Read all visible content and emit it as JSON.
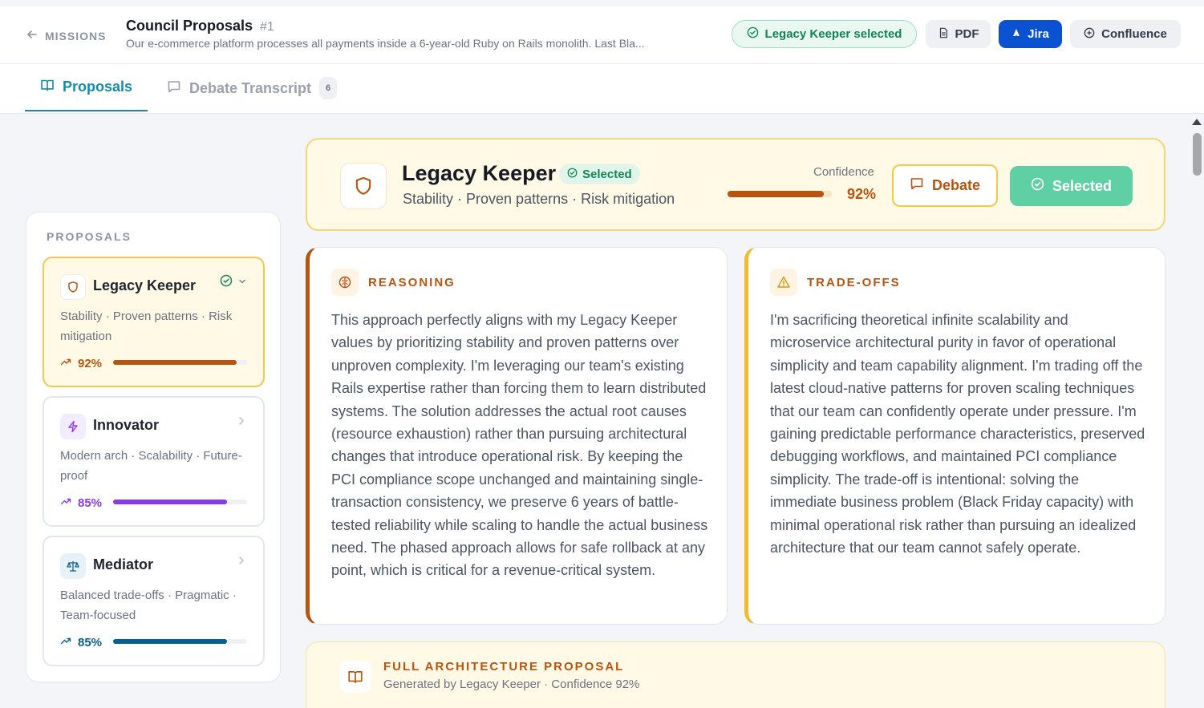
{
  "header": {
    "back_label": "MISSIONS",
    "title": "Council Proposals",
    "title_number": "#1",
    "subtitle": "Our e-commerce platform processes all payments inside a 6-year-old Ruby on Rails monolith. Last Bla...",
    "selected_pill": "Legacy Keeper selected",
    "pdf_label": "PDF",
    "jira_label": "Jira",
    "confluence_label": "Confluence"
  },
  "tabs": [
    {
      "label": "Proposals",
      "active": true
    },
    {
      "label": "Debate Transcript",
      "count": "6"
    }
  ],
  "sidebar": {
    "heading": "PROPOSALS",
    "items": [
      {
        "name": "Legacy Keeper",
        "tags": "Stability · Proven patterns · Risk mitigation",
        "confidence": "92%",
        "confidence_value": 0.92,
        "color": "#b7540f",
        "icon": "shield-icon",
        "selected": true
      },
      {
        "name": "Innovator",
        "tags": "Modern arch · Scalability · Future-proof",
        "confidence": "85%",
        "confidence_value": 0.85,
        "color": "#8a3ae8",
        "icon": "lightning-icon"
      },
      {
        "name": "Mediator",
        "tags": "Balanced trade-offs · Pragmatic · Team-focused",
        "confidence": "85%",
        "confidence_value": 0.85,
        "color": "#0b5f8f",
        "icon": "scale-icon"
      }
    ]
  },
  "hero": {
    "name": "Legacy Keeper",
    "badge": "Selected",
    "tags": "Stability · Proven patterns · Risk mitigation",
    "confidence_label": "Confidence",
    "confidence": "92%",
    "confidence_value": 0.92,
    "debate_label": "Debate",
    "selected_label": "Selected"
  },
  "reasoning": {
    "title": "REASONING",
    "text": "This approach perfectly aligns with my Legacy Keeper values by prioritizing stability and proven patterns over unproven complexity. I'm leveraging our team's existing Rails expertise rather than forcing them to learn distributed systems. The solution addresses the actual root causes (resource exhaustion) rather than pursuing architectural changes that introduce operational risk. By keeping the PCI compliance scope unchanged and maintaining single-transaction consistency, we preserve 6 years of battle-tested reliability while scaling to handle the actual business need. The phased approach allows for safe rollback at any point, which is critical for a revenue-critical system."
  },
  "tradeoffs": {
    "title": "TRADE-OFFS",
    "text": "I'm sacrificing theoretical infinite scalability and microservice architectural purity in favor of operational simplicity and team capability alignment. I'm trading off the latest cloud-native patterns for proven scaling techniques that our team can confidently operate under pressure. I'm gaining predictable performance characteristics, preserved debugging workflows, and maintained PCI compliance simplicity. The trade-off is intentional: solving the immediate business problem (Black Friday capacity) with minimal operational risk rather than pursuing an idealized architecture that our team cannot safely operate."
  },
  "full_proposal": {
    "title": "FULL ARCHITECTURE PROPOSAL",
    "subtitle": "Generated by Legacy Keeper · Confidence 92%"
  },
  "colors": {
    "accent": "#168aa6",
    "legacy": "#b7540f",
    "success": "#13855b",
    "jira": "#0b52d3"
  }
}
